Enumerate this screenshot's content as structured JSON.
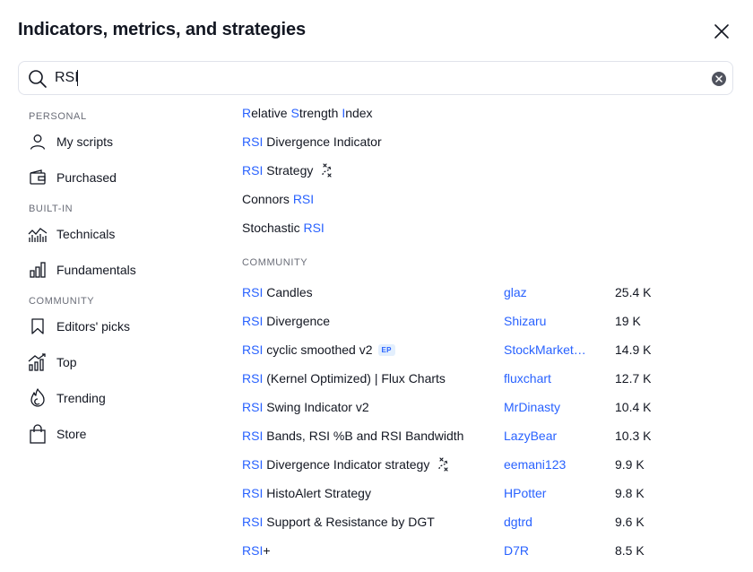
{
  "dialog": {
    "title": "Indicators, metrics, and strategies"
  },
  "search": {
    "value": "RSI"
  },
  "sidebar": {
    "sections": [
      {
        "label": "PERSONAL",
        "items": [
          {
            "label": "My scripts",
            "icon": "user-icon"
          },
          {
            "label": "Purchased",
            "icon": "wallet-icon"
          }
        ]
      },
      {
        "label": "BUILT-IN",
        "items": [
          {
            "label": "Technicals",
            "icon": "technicals-chart-icon"
          },
          {
            "label": "Fundamentals",
            "icon": "bar-chart-icon"
          }
        ]
      },
      {
        "label": "COMMUNITY",
        "items": [
          {
            "label": "Editors' picks",
            "icon": "bookmark-icon"
          },
          {
            "label": "Top",
            "icon": "top-chart-icon"
          },
          {
            "label": "Trending",
            "icon": "flame-icon"
          },
          {
            "label": "Store",
            "icon": "shopping-bag-icon"
          }
        ]
      }
    ]
  },
  "builtin_results": [
    {
      "parts": [
        [
          "R",
          "hl"
        ],
        [
          "elative ",
          ""
        ],
        [
          "S",
          "hl"
        ],
        [
          "trength ",
          ""
        ],
        [
          "I",
          "hl"
        ],
        [
          "ndex",
          ""
        ]
      ],
      "strategy": false
    },
    {
      "parts": [
        [
          "RSI",
          "hl"
        ],
        [
          " Divergence Indicator",
          ""
        ]
      ],
      "strategy": false
    },
    {
      "parts": [
        [
          "RSI",
          "hl"
        ],
        [
          " Strategy",
          ""
        ]
      ],
      "strategy": true
    },
    {
      "parts": [
        [
          "Connors ",
          ""
        ],
        [
          "RSI",
          "hl"
        ]
      ],
      "strategy": false
    },
    {
      "parts": [
        [
          "Stochastic ",
          ""
        ],
        [
          "RSI",
          "hl"
        ]
      ],
      "strategy": false
    }
  ],
  "community_label": "COMMUNITY",
  "community_results": [
    {
      "parts": [
        [
          "RSI",
          "hl"
        ],
        [
          " Candles",
          ""
        ]
      ],
      "author": "glaz",
      "count": "25.4 K",
      "strategy": false
    },
    {
      "parts": [
        [
          "RSI",
          "hl"
        ],
        [
          " Divergence",
          ""
        ]
      ],
      "author": "Shizaru",
      "count": "19 K",
      "strategy": false
    },
    {
      "parts": [
        [
          "RSI",
          "hl"
        ],
        [
          " cyclic smoothed v2",
          ""
        ]
      ],
      "author": "StockMarket…",
      "count": "14.9 K",
      "strategy": false,
      "badge": "EP"
    },
    {
      "parts": [
        [
          "RSI",
          "hl"
        ],
        [
          " (Kernel Optimized) | Flux Charts",
          ""
        ]
      ],
      "author": "fluxchart",
      "count": "12.7 K",
      "strategy": false
    },
    {
      "parts": [
        [
          "RSI",
          "hl"
        ],
        [
          " Swing Indicator v2",
          ""
        ]
      ],
      "author": "MrDinasty",
      "count": "10.4 K",
      "strategy": false
    },
    {
      "parts": [
        [
          "RSI",
          "hl"
        ],
        [
          " Bands, RSI %B and RSI Bandwidth",
          ""
        ]
      ],
      "author": "LazyBear",
      "count": "10.3 K",
      "strategy": false
    },
    {
      "parts": [
        [
          "RSI",
          "hl"
        ],
        [
          " Divergence Indicator strategy",
          ""
        ]
      ],
      "author": "eemani123",
      "count": "9.9 K",
      "strategy": true
    },
    {
      "parts": [
        [
          "RSI",
          "hl"
        ],
        [
          " HistoAlert Strategy",
          ""
        ]
      ],
      "author": "HPotter",
      "count": "9.8 K",
      "strategy": false
    },
    {
      "parts": [
        [
          "RSI",
          "hl"
        ],
        [
          " Support & Resistance by DGT",
          ""
        ]
      ],
      "author": "dgtrd",
      "count": "9.6 K",
      "strategy": false
    },
    {
      "parts": [
        [
          "RSI",
          "hl"
        ],
        [
          "+",
          ""
        ]
      ],
      "author": "D7R",
      "count": "8.5 K",
      "strategy": false
    }
  ],
  "colors": {
    "accent": "#2962ff",
    "text": "#131722",
    "muted": "#6a6d78",
    "border": "#e0e3eb"
  }
}
